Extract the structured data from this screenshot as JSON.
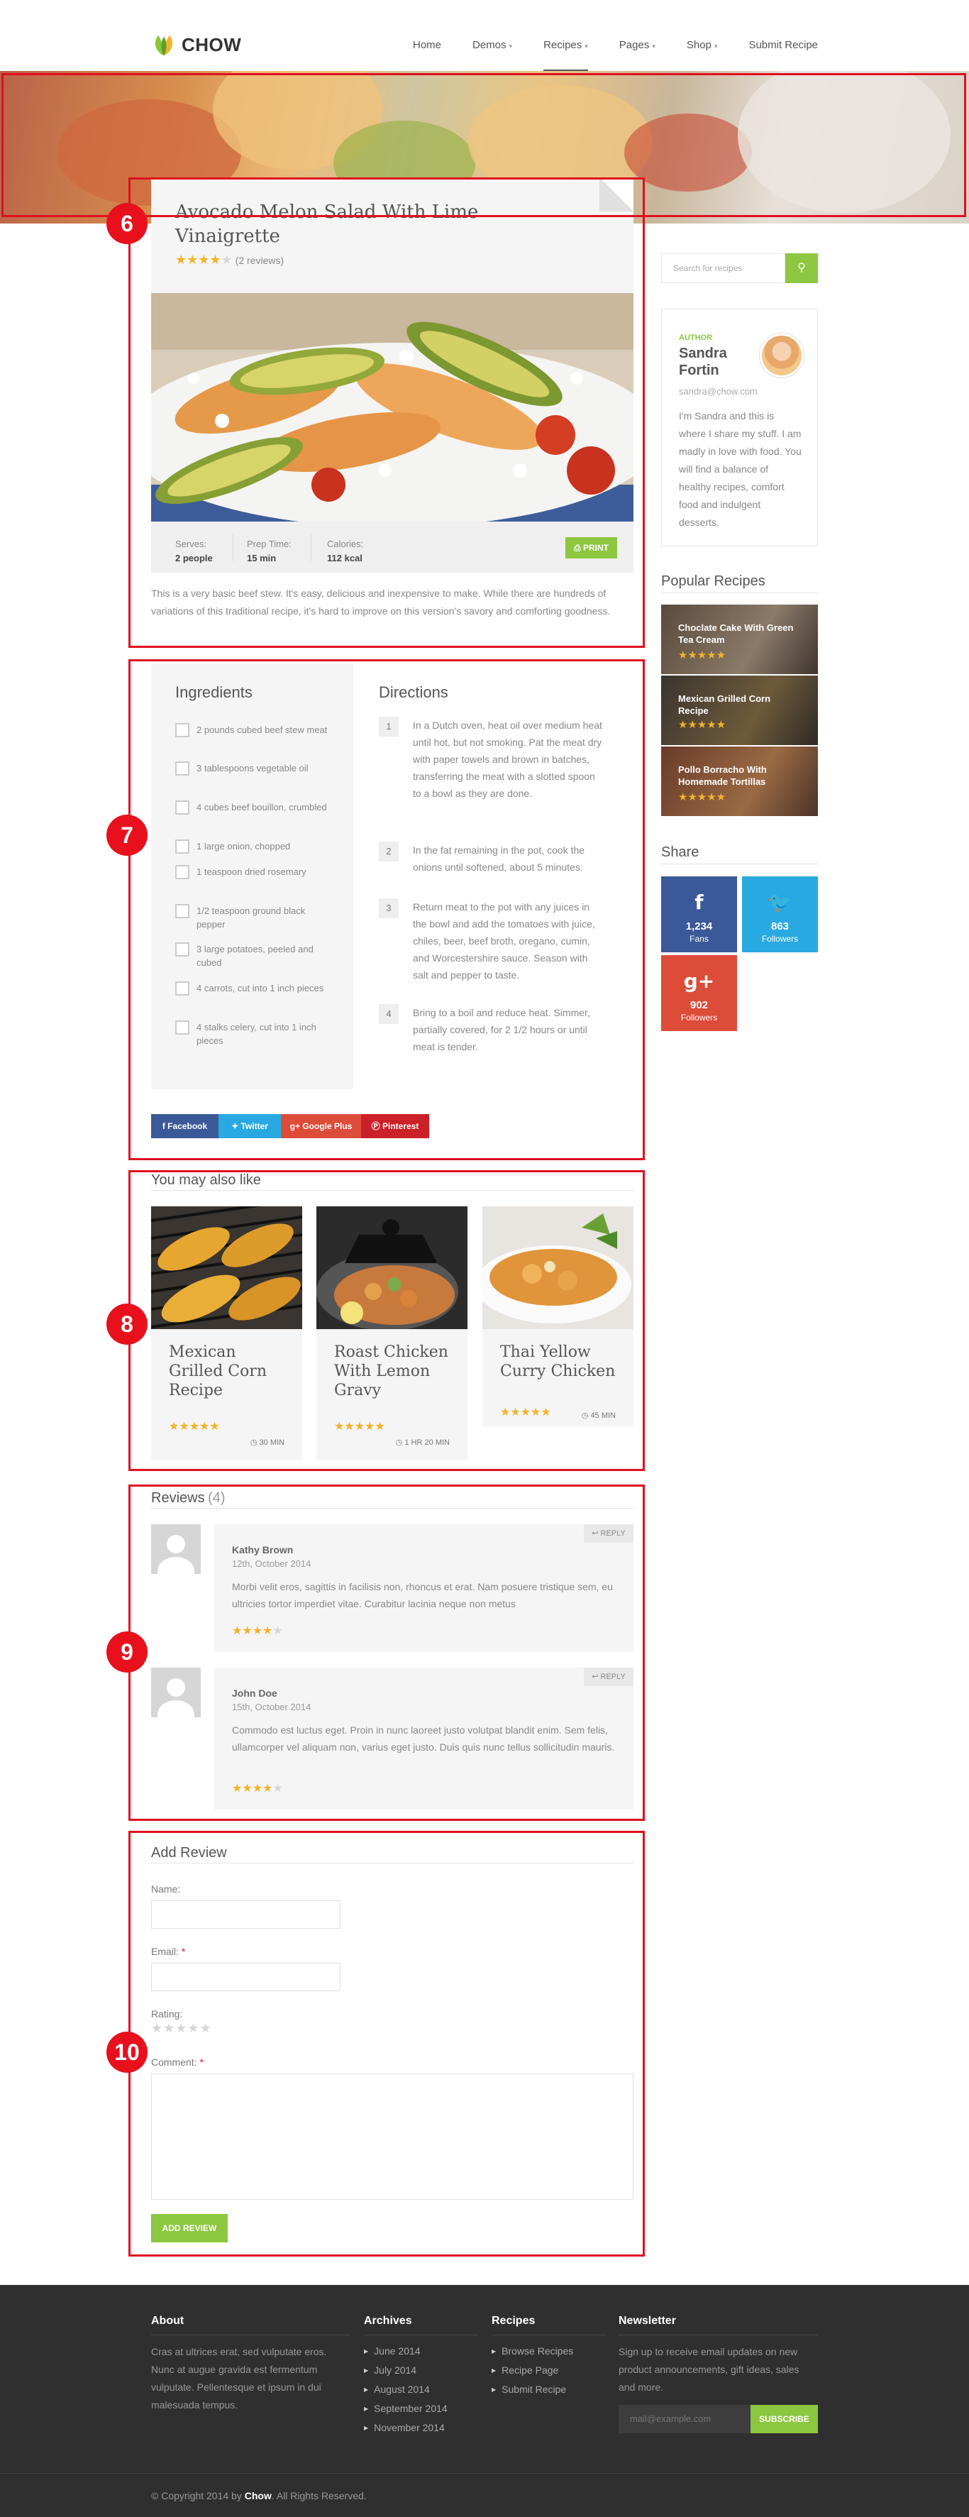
{
  "header": {
    "logo": "CHOW",
    "nav": [
      {
        "label": "Home",
        "caret": false
      },
      {
        "label": "Demos",
        "caret": true
      },
      {
        "label": "Recipes",
        "caret": true,
        "active": true
      },
      {
        "label": "Pages",
        "caret": true
      },
      {
        "label": "Shop",
        "caret": true
      },
      {
        "label": "Submit Recipe",
        "caret": false
      }
    ]
  },
  "annotations": [
    "6",
    "7",
    "8",
    "9",
    "10"
  ],
  "recipe": {
    "title": "Avocado Melon Salad With Lime Vinaigrette",
    "rating": 4,
    "reviews_label": "(2 reviews)",
    "meta": [
      {
        "label": "Serves:",
        "value": "2 people"
      },
      {
        "label": "Prep Time:",
        "value": "15 min"
      },
      {
        "label": "Calories:",
        "value": "112 kcal"
      }
    ],
    "print_label": "PRINT",
    "intro": "This is a very basic beef stew. It's easy, delicious and inexpensive to make. While there are hundreds of variations of this traditional recipe, it's hard to improve on this version's savory and comforting goodness."
  },
  "ingredients": {
    "title": "Ingredients",
    "items": [
      "2 pounds cubed beef stew meat",
      "3 tablespoons vegetable oil",
      "4 cubes beef bouillon, crumbled",
      "1 large onion, chopped",
      "1 teaspoon dried rosemary",
      "1/2 teaspoon ground black pepper",
      "3 large potatoes, peeled and cubed",
      "4 carrots, cut into 1 inch pieces",
      "4 stalks celery, cut into 1 inch pieces"
    ]
  },
  "directions": {
    "title": "Directions",
    "steps": [
      {
        "n": "1",
        "text": "In a Dutch oven, heat oil over medium heat until hot, but not smoking. Pat the meat dry with paper towels and brown in batches, transferring the meat with a slotted spoon to a bowl as they are done."
      },
      {
        "n": "2",
        "text": "In the fat remaining in the pot, cook the onions until softened, about 5 minutes."
      },
      {
        "n": "3",
        "text": "Return meat to the pot with any juices in the bowl and add the tomatoes with juice, chiles, beer, beef broth, oregano, cumin, and Worcestershire sauce. Season with salt and pepper to taste."
      },
      {
        "n": "4",
        "text": "Bring to a boil and reduce heat. Simmer, partially covered, for 2 1/2 hours or until meat is tender."
      }
    ]
  },
  "share_buttons": [
    {
      "label": "Facebook",
      "icon": "facebook-icon",
      "color": "#3b5998"
    },
    {
      "label": "Twitter",
      "icon": "twitter-icon",
      "color": "#29a9e1"
    },
    {
      "label": "Google Plus",
      "icon": "google-plus-icon",
      "color": "#dd4b39"
    },
    {
      "label": "Pinterest",
      "icon": "pinterest-icon",
      "color": "#cb2027"
    }
  ],
  "also_like": {
    "title": "You may also like",
    "items": [
      {
        "title": "Mexican Grilled Corn Recipe",
        "rating": 5,
        "time": "30 MIN"
      },
      {
        "title": "Roast Chicken With Lemon Gravy",
        "rating": 5,
        "time": "1 HR 20 MIN"
      },
      {
        "title": "Thai Yellow Curry Chicken",
        "rating": 5,
        "time": "45 MIN"
      }
    ]
  },
  "reviews": {
    "title": "Reviews",
    "count": "(4)",
    "reply_label": "REPLY",
    "items": [
      {
        "name": "Kathy Brown",
        "date": "12th, October 2014",
        "text": "Morbi velit eros, sagittis in facilisis non, rhoncus et erat. Nam posuere tristique sem, eu ultricies tortor imperdiet vitae. Curabitur lacinia neque non metus",
        "rating": 4
      },
      {
        "name": "John Doe",
        "date": "15th, October 2014",
        "text": "Commodo est luctus eget. Proin in nunc laoreet justo volutpat blandit enim. Sem felis, ullamcorper vel aliquam non, varius eget justo. Duis quis nunc tellus sollicitudin mauris.",
        "rating": 4
      }
    ]
  },
  "add_review": {
    "title": "Add Review",
    "name_label": "Name:",
    "email_label": "Email:",
    "rating_label": "Rating:",
    "comment_label": "Comment:",
    "required_mark": "*",
    "button_label": "ADD REVIEW"
  },
  "sidebar": {
    "search_placeholder": "Search for recipes",
    "author": {
      "label": "AUTHOR",
      "name": "Sandra Fortin",
      "email": "sandra@chow.com",
      "bio": "I'm Sandra and this is where I share my stuff. I am madly in love with food. You will find a balance of healthy recipes, comfort food and indulgent desserts."
    },
    "popular_title": "Popular Recipes",
    "popular": [
      {
        "title": "Choclate Cake With Green Tea Cream",
        "rating": 5
      },
      {
        "title": "Mexican Grilled Corn Recipe",
        "rating": 5
      },
      {
        "title": "Pollo Borracho With Homemade Tortillas",
        "rating": 5
      }
    ],
    "share_title": "Share",
    "social": [
      {
        "icon": "facebook-icon",
        "glyph": "f",
        "count": "1,234",
        "label": "Fans",
        "color": "#3b5998"
      },
      {
        "icon": "twitter-icon",
        "glyph": "🐦",
        "count": "863",
        "label": "Followers",
        "color": "#29a9e1"
      },
      {
        "icon": "google-plus-icon",
        "glyph": "g+",
        "count": "902",
        "label": "Followers",
        "color": "#dd4b39"
      }
    ]
  },
  "footer": {
    "about_title": "About",
    "about_text": "Cras at ultrices erat, sed vulputate eros. Nunc at augue gravida est fermentum vulputate. Pellentesque et ipsum in dui malesuada tempus.",
    "archives_title": "Archives",
    "archives": [
      "June 2014",
      "July 2014",
      "August 2014",
      "September 2014",
      "November 2014"
    ],
    "recipes_title": "Recipes",
    "recipes": [
      "Browse Recipes",
      "Recipe Page",
      "Submit Recipe"
    ],
    "newsletter_title": "Newsletter",
    "newsletter_text": "Sign up to receive email updates on new product announcements, gift ideas, sales and more.",
    "newsletter_placeholder": "mail@example.com",
    "subscribe_label": "SUBSCRIBE",
    "copyright_pre": "© Copyright 2014 by ",
    "copyright_brand": "Chow",
    "copyright_post": ". All Rights Reserved."
  },
  "colors": {
    "accent": "#8dc63f",
    "star": "#f3b328",
    "annotation": "#e01020"
  }
}
